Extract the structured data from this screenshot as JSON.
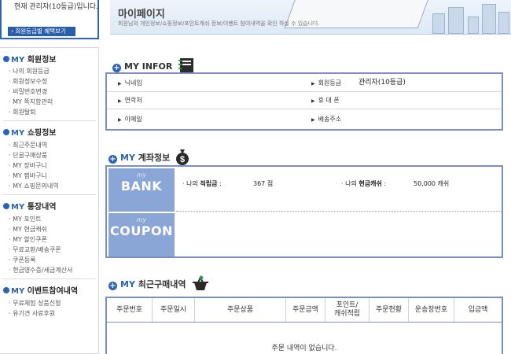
{
  "grade_box": {
    "text": "현재 관리자(10등급)입니다.",
    "button": "› 회원등급별 혜택보기"
  },
  "banner": {
    "title": "마이페이지",
    "subtitle": "회원님의 개인정보/쇼핑정보/포인트캐쉬 정보/이벤트 참여내역을 확인 하실 수 있습니다."
  },
  "sidebar": {
    "sections": [
      {
        "prefix": "MY",
        "title": "회원정보",
        "items": [
          "나의 회원등급",
          "회원정보수정",
          "비밀번호변경",
          "MY 쪽지함관리",
          "회원탈퇴"
        ]
      },
      {
        "prefix": "MY",
        "title": "쇼핑정보",
        "items": [
          "최근주문내역",
          "단골구매상품",
          "MY 장바구니",
          "MY 찜바구니",
          "MY 쇼핑문의내역"
        ]
      },
      {
        "prefix": "MY",
        "title": "통장내역",
        "items": [
          "MY 포인트",
          "MY 현금캐쉬",
          "MY 할인쿠폰",
          "무료교환/배송쿠폰",
          "쿠폰등록",
          "현금영수증/세금계산서"
        ]
      },
      {
        "prefix": "MY",
        "title": "이벤트참여내역",
        "items": [
          "무료체험 상품신청",
          "유기견 사료후원"
        ]
      }
    ]
  },
  "info": {
    "header": "MY INFOR",
    "rows": [
      {
        "left_label": "닉네임",
        "left_value": "",
        "right_label": "회원등급",
        "right_value": "관리자(10등급)"
      },
      {
        "left_label": "연락처",
        "left_value": "",
        "right_label": "휴 대 폰",
        "right_value": ""
      },
      {
        "left_label": "이메일",
        "left_value": "",
        "right_label": "배송주소",
        "right_value": ""
      }
    ]
  },
  "account": {
    "header_prefix": "MY",
    "header": "계좌정보",
    "bank_tile": {
      "small": "my",
      "big": "BANK"
    },
    "coupon_tile": {
      "small": "my",
      "big": "COUPON"
    },
    "points_label_pre": "나의",
    "points_label": "적립금",
    "points_colon": ":",
    "points_value": "367 점",
    "cash_label_pre": "나의",
    "cash_label": "현금캐쉬",
    "cash_colon": ":",
    "cash_value": "50,000 캐쉬"
  },
  "orders": {
    "header_prefix": "MY",
    "header": "최근구매내역",
    "columns": [
      "주문번호",
      "주문일시",
      "주문상품",
      "주문금액",
      "포인트/\n캐쉬적립",
      "주문현황",
      "운송장번호",
      "입금액"
    ],
    "empty_text": "주문 내역이 없습니다."
  },
  "colors": {
    "accent": "#2c63b3",
    "box_border": "#7b8fc2",
    "tile": "#8aa6d6"
  }
}
